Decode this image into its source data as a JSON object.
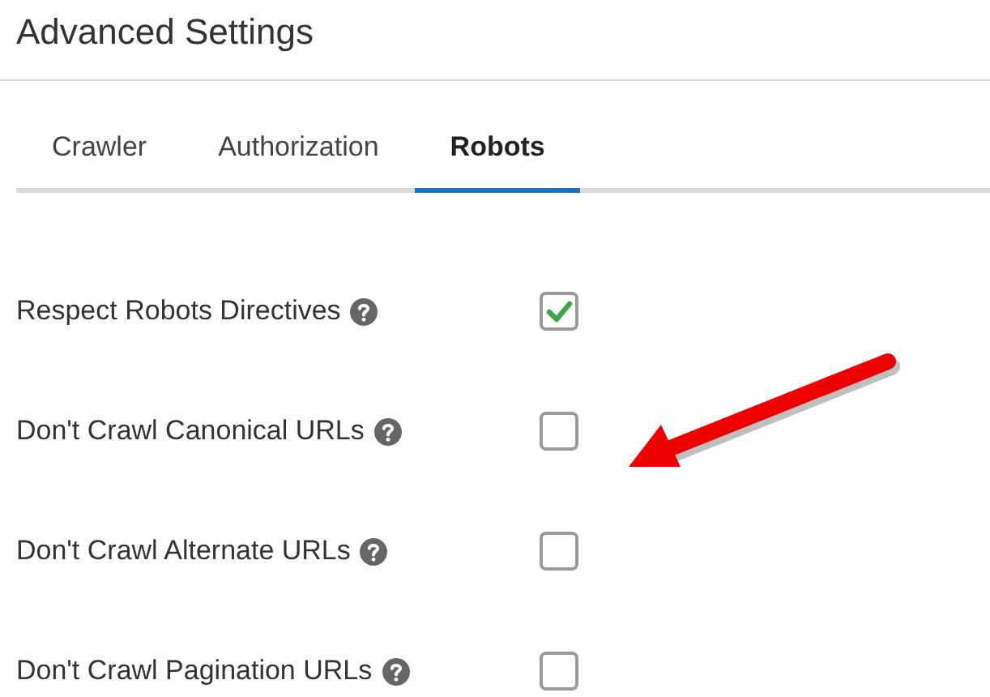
{
  "page_title": "Advanced Settings",
  "tabs": [
    {
      "label": "Crawler",
      "selected": false
    },
    {
      "label": "Authorization",
      "selected": false
    },
    {
      "label": "Robots",
      "selected": true
    }
  ],
  "settings": [
    {
      "label": "Respect Robots Directives",
      "checked": true
    },
    {
      "label": "Don't Crawl Canonical URLs",
      "checked": false
    },
    {
      "label": "Don't Crawl Alternate URLs",
      "checked": false
    },
    {
      "label": "Don't Crawl Pagination URLs",
      "checked": false
    }
  ]
}
